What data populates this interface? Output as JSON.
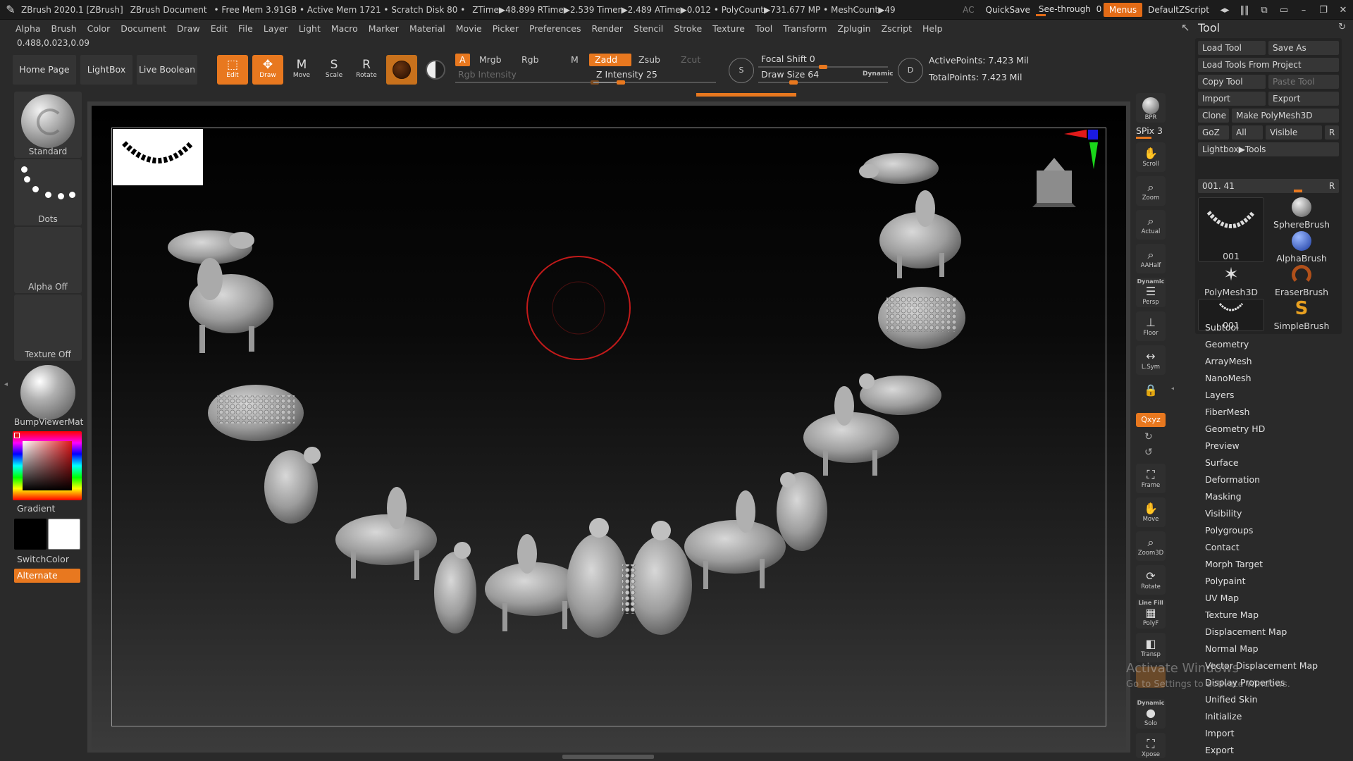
{
  "titlebar": {
    "app_title": "ZBrush 2020.1 [ZBrush]",
    "document": "ZBrush Document",
    "stats": "• Free Mem 3.91GB • Active Mem 1721 • Scratch Disk 80 •",
    "timings": "ZTime▶48.899 RTime▶2.539 Timer▶2.489 ATime▶0.012 • PolyCount▶731.677 MP • MeshCount▶49",
    "ac": "AC",
    "quicksave": "QuickSave",
    "seethrough_label": "See-through",
    "seethrough_value": "0",
    "menus_label": "Menus",
    "script_label": "DefaultZScript",
    "icons": [
      "layout-icon",
      "layout-icon-2",
      "palette-icon",
      "monitor-icon",
      "minimize-icon",
      "restore-icon",
      "close-icon"
    ]
  },
  "menubar": [
    "Alpha",
    "Brush",
    "Color",
    "Document",
    "Draw",
    "Edit",
    "File",
    "Layer",
    "Light",
    "Macro",
    "Marker",
    "Material",
    "Movie",
    "Picker",
    "Preferences",
    "Render",
    "Stencil",
    "Stroke",
    "Texture",
    "Tool",
    "Transform",
    "Zplugin",
    "Zscript",
    "Help"
  ],
  "coords": "0.488,0.023,0.09",
  "toolbar": {
    "home_page": "Home Page",
    "lightbox": "LightBox",
    "live_boolean": "Live Boolean",
    "edit": "Edit",
    "draw": "Draw",
    "move": "Move",
    "scale": "Scale",
    "rotate": "Rotate",
    "a_label": "A",
    "mrgb": "Mrgb",
    "rgb": "Rgb",
    "m": "M",
    "rgb_intensity": "Rgb Intensity",
    "zadd": "Zadd",
    "zsub": "Zsub",
    "zcut": "Zcut",
    "z_intensity_label": "Z Intensity",
    "z_intensity_value": "25",
    "z_intensity_fraction": 0.25,
    "s_label": "S",
    "focal_shift_label": "Focal Shift",
    "focal_shift_value": "0",
    "draw_size_label": "Draw Size",
    "draw_size_value": "64",
    "dynamic": "Dynamic",
    "d_label": "D",
    "active_points": "ActivePoints: 7.423 Mil",
    "total_points": "TotalPoints: 7.423 Mil"
  },
  "leftshelf": {
    "standard": "Standard",
    "dots": "Dots",
    "alpha_off": "Alpha Off",
    "texture_off": "Texture Off",
    "material": "BumpViewerMat",
    "gradient": "Gradient",
    "switchcolor": "SwitchColor",
    "alternate": "Alternate",
    "main_color": "#ffffff",
    "secondary_color": "#000000",
    "picked_color": "#e0161a"
  },
  "rightshelf": {
    "bpr": "BPR",
    "spix": "SPix 3",
    "scroll": "Scroll",
    "zoom": "Zoom",
    "actual": "Actual",
    "aahalf": "AAHalf",
    "dynamic": "Dynamic",
    "persp": "Persp",
    "floor": "Floor",
    "lsym": "L.Sym",
    "xyz": "Qxyz",
    "frame": "Frame",
    "move": "Move",
    "zoom3d": "Zoom3D",
    "rotate": "Rotate",
    "linefill": "Line Fill",
    "polyf": "PolyF",
    "transp": "Transp",
    "dynamic2": "Dynamic",
    "solo": "Solo",
    "xpose": "Xpose"
  },
  "toolpanel": {
    "title": "Tool",
    "load_tool": "Load Tool",
    "save_as": "Save As",
    "load_from_project": "Load Tools From Project",
    "copy_tool": "Copy Tool",
    "paste_tool": "Paste Tool",
    "import": "Import",
    "export": "Export",
    "clone": "Clone",
    "make_polymesh": "Make PolyMesh3D",
    "goz": "GoZ",
    "all": "All",
    "visible": "Visible",
    "r": "R",
    "lightbox_tools": "Lightbox▶Tools",
    "current_tool": "001. 41",
    "tools": [
      {
        "label": "001",
        "icon": "necklace-icon"
      },
      {
        "label": "SphereBrush",
        "icon": "sphere-icon"
      },
      {
        "label": "AlphaBrush",
        "icon": "alpha-brush-icon"
      },
      {
        "label": "PolyMesh3D",
        "icon": "star-icon"
      },
      {
        "label": "EraserBrush",
        "icon": "eraser-icon"
      },
      {
        "label": "001",
        "icon": "necklace-small-icon"
      },
      {
        "label": "SimpleBrush",
        "icon": "simple-brush-icon"
      }
    ],
    "menu": [
      "Subtool",
      "Geometry",
      "ArrayMesh",
      "NanoMesh",
      "Layers",
      "FiberMesh",
      "Geometry HD",
      "Preview",
      "Surface",
      "Deformation",
      "Masking",
      "Visibility",
      "Polygroups",
      "Contact",
      "Morph Target",
      "Polypaint",
      "UV Map",
      "Texture Map",
      "Displacement Map",
      "Normal Map",
      "Vector Displacement Map",
      "Display Properties",
      "Unified Skin",
      "Initialize",
      "Import",
      "Export"
    ]
  },
  "watermark": {
    "line1": "Activate Windows",
    "line2": "Go to Settings to activate Windows."
  }
}
